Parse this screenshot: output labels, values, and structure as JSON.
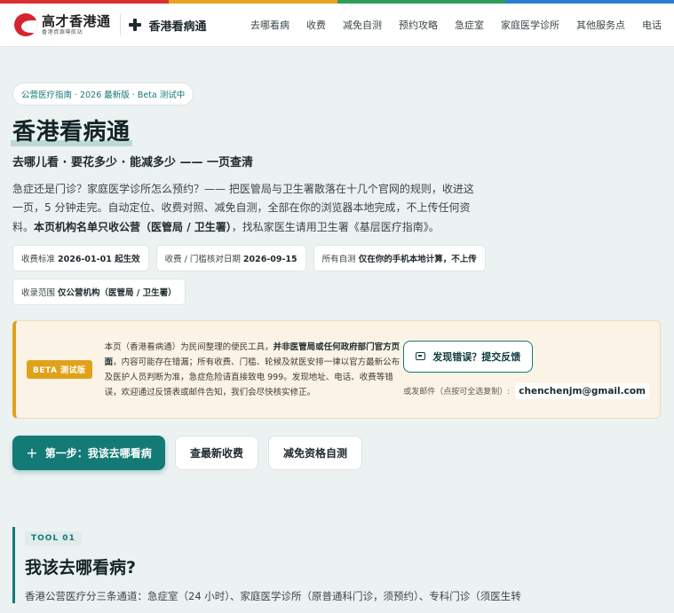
{
  "colors": {
    "stripe": [
      "#d9322f",
      "#e9a21f",
      "#2e9f5a",
      "#2b7fd1"
    ],
    "accent": "#137a76",
    "warning": "#e0a21a"
  },
  "brand": {
    "title": "高才香港通",
    "subtitle": "香港資源導航站",
    "app_name": "香港看病通"
  },
  "nav": [
    "去哪看病",
    "收费",
    "减免自测",
    "预约攻略",
    "急症室",
    "家庭医学诊所",
    "其他服务点",
    "电话"
  ],
  "hero": {
    "pill": "公营医疗指南 · 2026 最新版 · Beta 测试中",
    "title": "香港看病通",
    "subtitle": "去哪儿看 · 要花多少 · 能减多少 —— 一页查清",
    "desc_1": "急症还是门诊？家庭医学诊所怎么预约？—— 把医管局与卫生署散落在十几个官网的规则，收进这一页，5 分钟走完。自动定位、收费对照、减免自测，全部在你的浏览器本地完成，不上传任何资料。",
    "desc_bold": "本页机构名单只收公营（医管局 / 卫生署）",
    "desc_2": "，找私家医生请用卫生署《基层医疗指南》。"
  },
  "chips": [
    {
      "label": "收费标准 ",
      "value": "2026-01-01 起生效"
    },
    {
      "label": "收费 / 门槛核对日期 ",
      "value": "2026-09-15"
    },
    {
      "label": "所有自测 ",
      "value": "仅在你的手机本地计算，不上传"
    },
    {
      "label": "收录范围 ",
      "value": "仅公营机构（医管局 / 卫生署）"
    }
  ],
  "notice": {
    "badge": "BETA 测试版",
    "text_1": "本页（香港看病通）为民间整理的便民工具，",
    "text_bold": "并非医管局或任何政府部门官方页面",
    "text_2": "，内容可能存在错漏；所有收费、门槛、轮候及就医安排一律以官方最新公布及医护人员判断为准，急症危险请直接致电 999。发现地址、电话、收费等错误，欢迎通过反馈表或邮件告知，我们会尽快核实修正。",
    "feedback_button": "发现错误？提交反馈",
    "email_label": "或发邮件（点按可全选复制）:",
    "email": "chenchenjm@gmail.com"
  },
  "actions": {
    "primary_icon": "+",
    "primary": "第一步：我该去哪看病",
    "fees": "查最新收费",
    "waiver": "减免资格自测"
  },
  "tool": {
    "badge": "TOOL 01",
    "title": "我该去哪看病?",
    "desc": "香港公营医疗分三条通道：急症室（24 小时）、家庭医学诊所（原普通科门诊，须预约）、专科门诊（须医生转"
  }
}
